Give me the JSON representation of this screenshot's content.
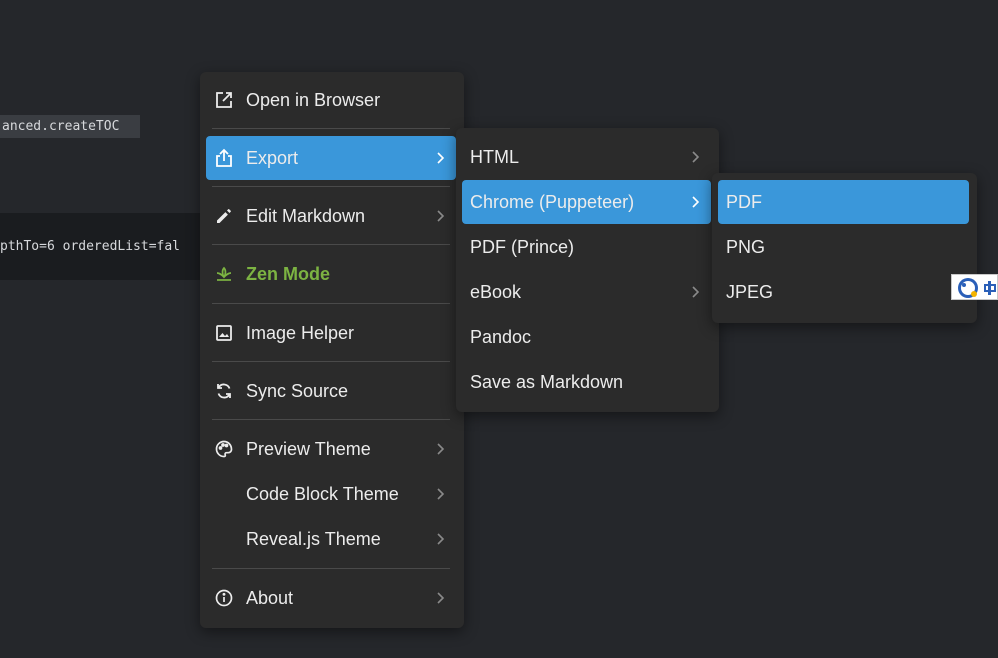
{
  "editor": {
    "inline_code": "anced.createTOC",
    "code_line": "pthTo=6 orderedList=fal"
  },
  "main_menu": {
    "items": [
      {
        "label": "Open in Browser",
        "icon": "external-link-icon"
      },
      {
        "label": "Export",
        "icon": "share-icon",
        "has_submenu": true,
        "active": true
      },
      {
        "label": "Edit Markdown",
        "icon": "pencil-icon",
        "has_submenu": true
      },
      {
        "label": "Zen Mode",
        "icon": "zen-lotus-icon",
        "color": "#7cb342"
      },
      {
        "label": "Image Helper",
        "icon": "image-icon"
      },
      {
        "label": "Sync Source",
        "icon": "sync-icon"
      },
      {
        "label": "Preview Theme",
        "icon": "palette-icon",
        "has_submenu": true
      },
      {
        "label": "Code Block Theme",
        "has_submenu": true
      },
      {
        "label": "Reveal.js Theme",
        "has_submenu": true
      },
      {
        "label": "About",
        "icon": "info-icon",
        "has_submenu": true
      }
    ]
  },
  "export_menu": {
    "items": [
      {
        "label": "HTML",
        "has_submenu": true
      },
      {
        "label": "Chrome (Puppeteer)",
        "has_submenu": true,
        "active": true
      },
      {
        "label": "PDF (Prince)"
      },
      {
        "label": "eBook",
        "has_submenu": true
      },
      {
        "label": "Pandoc"
      },
      {
        "label": "Save as Markdown"
      }
    ]
  },
  "chrome_menu": {
    "items": [
      {
        "label": "PDF",
        "active": true
      },
      {
        "label": "PNG"
      },
      {
        "label": "JPEG"
      }
    ]
  },
  "colors": {
    "background": "#25272b",
    "menu": "#2b2b2b",
    "accent": "#3a97da",
    "zen": "#7cb342"
  }
}
